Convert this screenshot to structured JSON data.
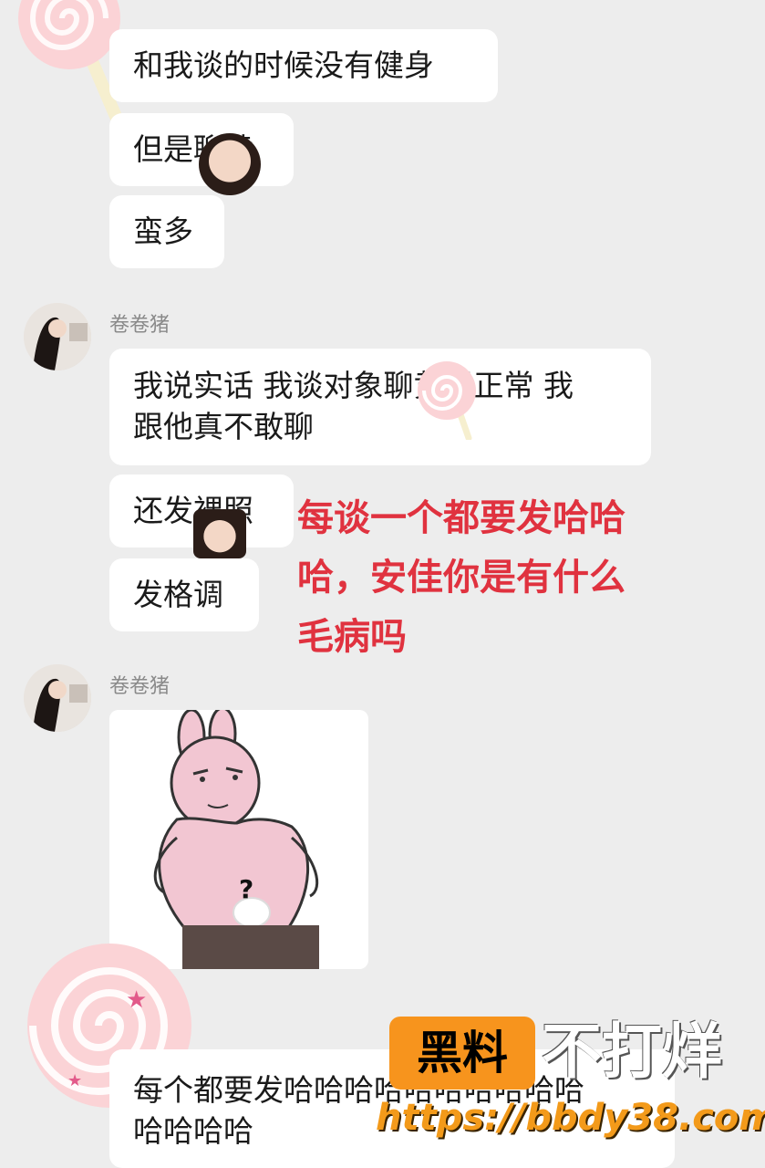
{
  "messages_top": [
    {
      "text": "和我谈的时候没有健身"
    },
    {
      "text": "但是聊黄"
    },
    {
      "text": "蛮多"
    }
  ],
  "group1": {
    "sender": "卷卷猪",
    "messages": [
      {
        "text_line1": "我说实话 我谈对象聊黄很正常 我",
        "text_line2": "跟他真不敢聊"
      },
      {
        "text": "还发裸照"
      },
      {
        "text": "发格调"
      }
    ]
  },
  "overlay_caption": {
    "line1": "每谈一个都要发哈哈",
    "line2": "哈，安佳你是有什么",
    "line3": "毛病吗",
    "color": "#e0323f"
  },
  "group2": {
    "sender": "卷卷猪",
    "sticker": {
      "mark": "?",
      "icon": "pink-rabbit-meme-sticker"
    }
  },
  "bottom_message": {
    "line1": "每个都要发哈哈哈哈哈哈哈哈哈哈",
    "line2": "哈哈哈哈"
  },
  "watermark": {
    "badge": "黑料",
    "title": "不打烊",
    "url": "https://bbdy38.com"
  }
}
